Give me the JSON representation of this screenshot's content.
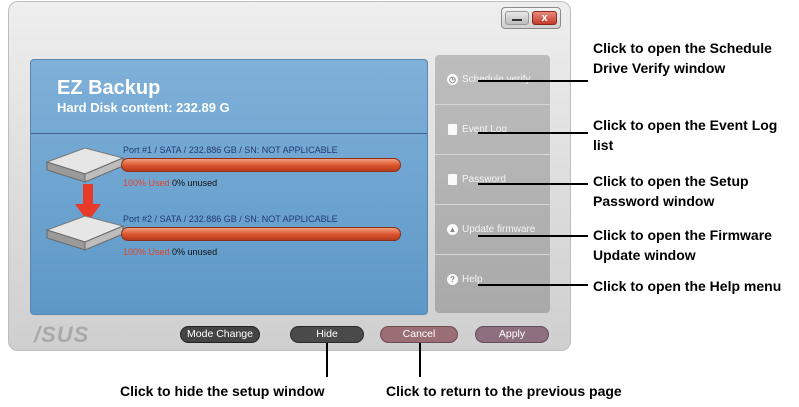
{
  "window": {
    "title": "EZ Backup",
    "subtitle": "Hard Disk content: 232.89 G",
    "close_glyph": "x"
  },
  "ports": [
    {
      "info": "Port #1 / SATA / 232.886 GB / SN: NOT APPLICABLE",
      "used": "100% Used",
      "unused": "0% unused",
      "used_fraction": 1.0
    },
    {
      "info": "Port #2 / SATA / 232.886 GB / SN: NOT APPLICABLE",
      "used": "100% Used",
      "unused": "0% unused",
      "used_fraction": 1.0
    }
  ],
  "sidebar": {
    "items": [
      {
        "label": "Schedule verify",
        "icon": "clock-icon"
      },
      {
        "label": "Event Log",
        "icon": "document-icon"
      },
      {
        "label": "Password",
        "icon": "lock-icon"
      },
      {
        "label": "Update firmware",
        "icon": "arrow-up-icon"
      },
      {
        "label": "Help",
        "icon": "help-icon"
      }
    ]
  },
  "footer": {
    "logo": "/SUS",
    "mode_change": "Mode Change",
    "hide": "Hide",
    "cancel": "Cancel",
    "apply": "Apply"
  },
  "callouts": {
    "schedule": "Click to open the Schedule Drive Verify window",
    "eventlog": "Click to open the Event Log list",
    "password": "Click to open the Setup Password window",
    "firmware": "Click to open the Firmware Update window",
    "help": "Click to open the Help menu",
    "hide": "Click to hide the setup window",
    "cancel": "Click to return to the previous page"
  },
  "colors": {
    "panel": "#6aa2cf",
    "bar": "#d9532c",
    "used_text": "#e2462a",
    "hide_button": "#4a4a4a",
    "cancel_button": "#9a6e74",
    "apply_button": "#8e6f80"
  }
}
